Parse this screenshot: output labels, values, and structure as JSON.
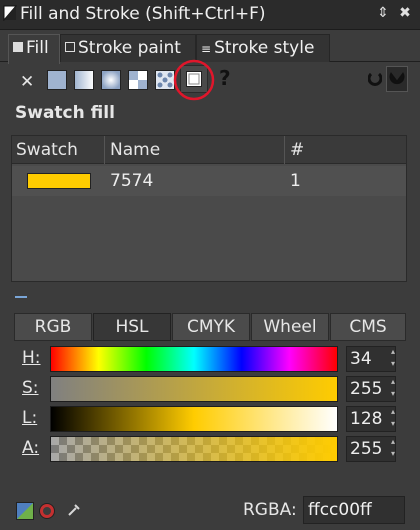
{
  "window": {
    "title": "Fill and Stroke (Shift+Ctrl+F)",
    "menu_icon": "scroll-arrows-icon",
    "close_icon": "close-icon"
  },
  "tabs": [
    {
      "label": "Fill",
      "active": true
    },
    {
      "label": "Stroke paint",
      "active": false
    },
    {
      "label": "Stroke style",
      "active": false
    }
  ],
  "paint_modes": [
    {
      "name": "no-paint",
      "icon": "x-icon"
    },
    {
      "name": "flat-color",
      "icon": "flat-color-icon"
    },
    {
      "name": "linear-gradient",
      "icon": "linear-gradient-icon"
    },
    {
      "name": "radial-gradient",
      "icon": "radial-gradient-icon"
    },
    {
      "name": "mesh-gradient",
      "icon": "mesh-gradient-icon"
    },
    {
      "name": "pattern",
      "icon": "pattern-icon"
    },
    {
      "name": "swatch",
      "icon": "swatch-icon",
      "active": true
    },
    {
      "name": "unset",
      "icon": "question-icon"
    }
  ],
  "fill_rule_icons": [
    "evenodd-icon",
    "nonzero-icon"
  ],
  "section_title": "Swatch fill",
  "swatch_table": {
    "headers": [
      "Swatch",
      "Name",
      "#"
    ],
    "rows": [
      {
        "color": "#ffcc00",
        "name": "7574",
        "count": "1"
      }
    ]
  },
  "color_modes": [
    {
      "label": "RGB",
      "active": false
    },
    {
      "label": "HSL",
      "active": true
    },
    {
      "label": "CMYK",
      "active": false
    },
    {
      "label": "Wheel",
      "active": false
    },
    {
      "label": "CMS",
      "active": false
    }
  ],
  "sliders": [
    {
      "label": "H:",
      "value": "34",
      "level": 0.133
    },
    {
      "label": "S:",
      "value": "255",
      "level": 1.0
    },
    {
      "label": "L:",
      "value": "128",
      "level": 0.5
    },
    {
      "label": "A:",
      "value": "255",
      "level": 1.0
    }
  ],
  "rgba": {
    "label": "RGBA:",
    "value": "ffcc00ff"
  },
  "accent_color": "#ffcc00",
  "highlight_circle_color": "#e0162b"
}
